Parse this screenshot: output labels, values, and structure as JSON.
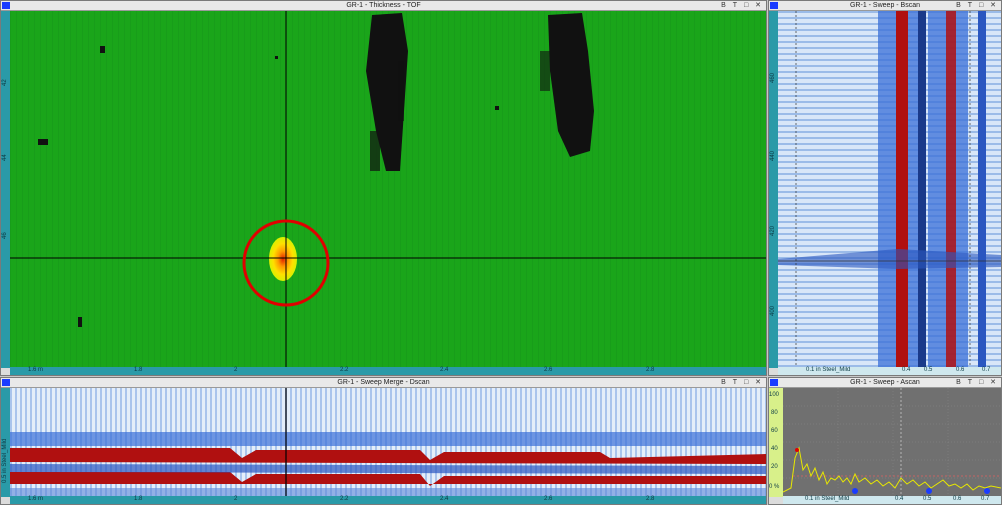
{
  "panels": {
    "thickness": {
      "title": "GR-1 - Thickness - TOF",
      "controls": [
        "B",
        "T",
        "□",
        "✕"
      ],
      "x_ticks": [
        "1.6 m",
        "1.8",
        "2",
        "2.2",
        "2.4",
        "2.6",
        "2.8"
      ],
      "y_ticks": [
        "42",
        "44",
        "46"
      ]
    },
    "bscan": {
      "title": "GR-1 - Sweep - Bscan",
      "controls": [
        "B",
        "T",
        "□",
        "✕"
      ],
      "y_ticks": [
        "460",
        "440",
        "420",
        "400"
      ],
      "x_label": "0.1 in Steel_Mild",
      "x_ticks": [
        "0.4",
        "0.5",
        "0.6",
        "0.7"
      ]
    },
    "dscan": {
      "title": "GR-1 - Sweep Merge - Dscan",
      "controls": [
        "B",
        "T",
        "□",
        "✕"
      ],
      "y_label": "0.5 in Steel_Mild",
      "x_ticks": [
        "1.6 m",
        "1.8",
        "2",
        "2.2",
        "2.4",
        "2.6",
        "2.8"
      ]
    },
    "ascan": {
      "title": "GR-1 - Sweep - Ascan",
      "controls": [
        "B",
        "T",
        "□",
        "✕"
      ],
      "y_ticks": [
        "100",
        "80",
        "60",
        "40",
        "20",
        "0 %"
      ],
      "x_label": "0.1 in Steel_Mild",
      "x_ticks": [
        "0.4",
        "0.5",
        "0.6",
        "0.7"
      ]
    }
  },
  "colors": {
    "green": "#1aa51a",
    "defect_circle": "#e00000",
    "bscan_blue": "#3a6fd8",
    "ascan_signal": "#e8e800",
    "ascan_bg": "#707070",
    "ruler": "#2a9aa8"
  }
}
